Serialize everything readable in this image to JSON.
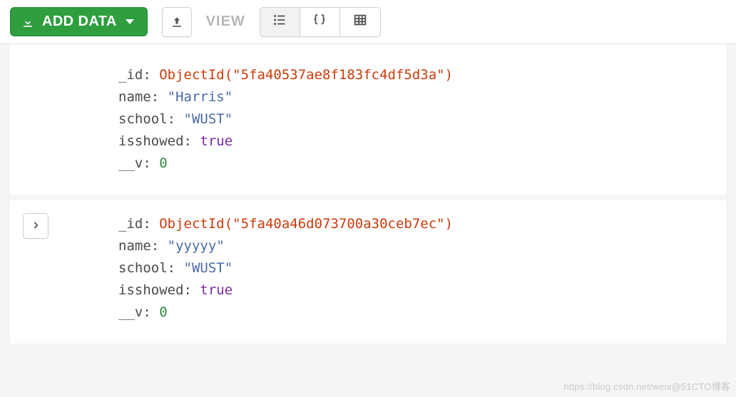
{
  "toolbar": {
    "add_data_label": "ADD DATA",
    "view_label": "VIEW"
  },
  "documents": [
    {
      "fields": {
        "_id": {
          "key": "_id",
          "type": "objectid",
          "display": "5fa40537ae8f183fc4df5d3a"
        },
        "name": {
          "key": "name",
          "type": "string",
          "display": "Harris"
        },
        "school": {
          "key": "school",
          "type": "string",
          "display": "WUST"
        },
        "isshowed": {
          "key": "isshowed",
          "type": "bool",
          "display": "true"
        },
        "__v": {
          "key": "__v",
          "type": "number",
          "display": "0"
        }
      },
      "show_expand": false
    },
    {
      "fields": {
        "_id": {
          "key": "_id",
          "type": "objectid",
          "display": "5fa40a46d073700a30ceb7ec"
        },
        "name": {
          "key": "name",
          "type": "string",
          "display": "yyyyy"
        },
        "school": {
          "key": "school",
          "type": "string",
          "display": "WUST"
        },
        "isshowed": {
          "key": "isshowed",
          "type": "bool",
          "display": "true"
        },
        "__v": {
          "key": "__v",
          "type": "number",
          "display": "0"
        }
      },
      "show_expand": true
    }
  ],
  "watermark_left": "https://blog.csdn.net/weix",
  "watermark_right": "@51CTO博客"
}
